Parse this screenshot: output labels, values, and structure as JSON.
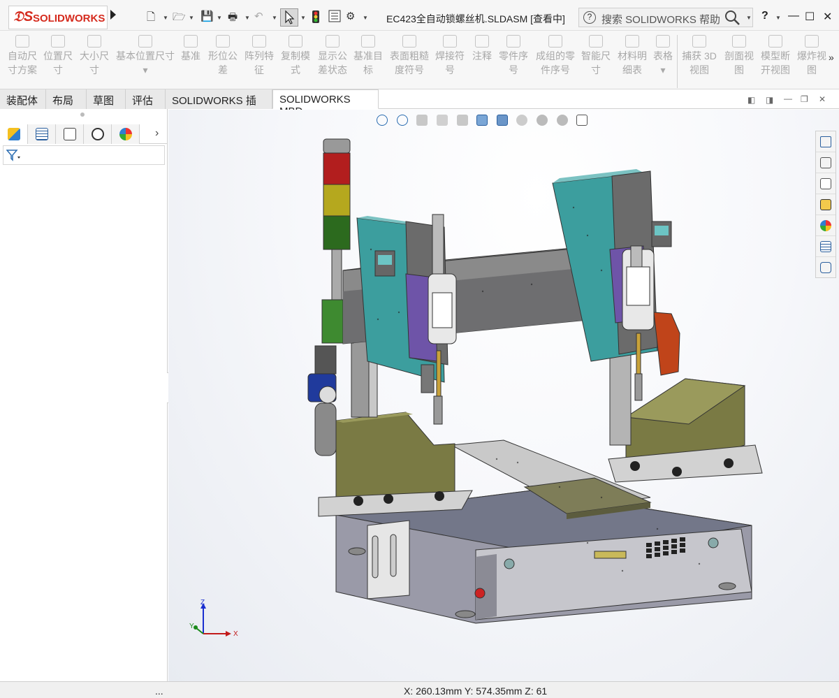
{
  "app": {
    "brand": "SOLIDWORKS",
    "document_title": "EC423全自动锁螺丝机.SLDASM [查看中]",
    "search_placeholder": "搜索 SOLIDWORKS 帮助",
    "help_label": "?",
    "brand_color": "#d52b1e"
  },
  "quick_access": [
    "new-file-icon",
    "open-file-icon",
    "save-icon",
    "print-icon",
    "undo-icon",
    "select-icon",
    "rebuild-icon",
    "file-properties-icon",
    "options-gear-icon"
  ],
  "ribbon": {
    "buttons": [
      {
        "label": "自动尺寸方案",
        "line1": "自动尺",
        "line2": "寸方案",
        "icon": "auto-dimension-icon"
      },
      {
        "label": "位置尺寸",
        "line1": "位置尺",
        "line2": "寸",
        "icon": "location-dimension-icon"
      },
      {
        "label": "大小尺寸",
        "line1": "大小尺",
        "line2": "寸",
        "icon": "size-dimension-icon"
      },
      {
        "label": "基本位置尺寸",
        "line1": "基本位置尺寸",
        "line2": "▾",
        "icon": "basic-location-dimension-icon"
      },
      {
        "label": "基准",
        "line1": "基准",
        "line2": "",
        "icon": "datum-icon"
      },
      {
        "label": "形位公差",
        "line1": "形位公",
        "line2": "差",
        "icon": "geometric-tolerance-icon"
      },
      {
        "label": "阵列特征",
        "line1": "阵列特",
        "line2": "征",
        "icon": "pattern-feature-icon"
      },
      {
        "label": "复制模式",
        "line1": "复制模",
        "line2": "式",
        "icon": "copy-scheme-icon"
      },
      {
        "label": "显示公差状态",
        "line1": "显示公",
        "line2": "差状态",
        "icon": "show-tolerance-status-icon"
      },
      {
        "label": "基准目标",
        "line1": "基准目",
        "line2": "标",
        "icon": "datum-target-icon"
      },
      {
        "label": "表面粗糙度符号",
        "line1": "表面粗糙",
        "line2": "度符号",
        "icon": "surface-finish-icon"
      },
      {
        "label": "焊接符号",
        "line1": "焊接符",
        "line2": "号",
        "icon": "weld-symbol-icon"
      },
      {
        "label": "注释",
        "line1": "注释",
        "line2": "",
        "icon": "note-icon"
      },
      {
        "label": "零件序号",
        "line1": "零件序",
        "line2": "号",
        "icon": "balloon-icon"
      },
      {
        "label": "成组的零件序号",
        "line1": "成组的零",
        "line2": "件序号",
        "icon": "stacked-balloon-icon"
      },
      {
        "label": "智能尺寸",
        "line1": "智能尺",
        "line2": "寸",
        "icon": "smart-dimension-icon"
      },
      {
        "label": "材料明细表",
        "line1": "材料明",
        "line2": "细表",
        "icon": "bom-icon"
      },
      {
        "label": "表格",
        "line1": "表格",
        "line2": "▾",
        "icon": "table-icon"
      },
      {
        "label": "捕获 3D 视图",
        "line1": "捕获 3D",
        "line2": "视图",
        "icon": "capture-3d-view-icon"
      },
      {
        "label": "剖面视图",
        "line1": "剖面视",
        "line2": "图",
        "icon": "section-view-icon"
      },
      {
        "label": "模型断开视图",
        "line1": "模型断",
        "line2": "开视图",
        "icon": "model-break-view-icon"
      },
      {
        "label": "爆炸视图",
        "line1": "爆炸视",
        "line2": "图",
        "icon": "exploded-view-icon"
      }
    ]
  },
  "tabs": [
    {
      "label": "装配体",
      "active": false
    },
    {
      "label": "布局",
      "active": false
    },
    {
      "label": "草图",
      "active": false
    },
    {
      "label": "评估",
      "active": false
    },
    {
      "label": "SOLIDWORKS 插件",
      "active": false
    },
    {
      "label": "SOLIDWORKS MBD",
      "active": true
    }
  ],
  "panel_tabs": [
    "featuremanager-icon",
    "propertymanager-icon",
    "configurationmanager-icon",
    "dimxpertmanager-icon",
    "displaymanager-icon"
  ],
  "status": {
    "left": "...",
    "coordinates": "X: 260.13mm Y: 574.35mm Z: 61"
  },
  "triad": {
    "x": "X",
    "y": "Y",
    "z": "Z"
  }
}
